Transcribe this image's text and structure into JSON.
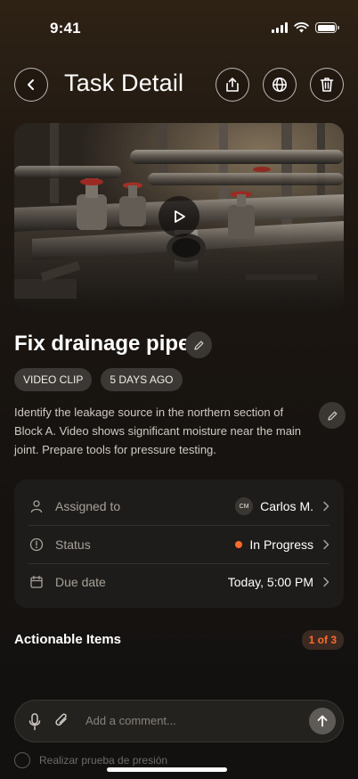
{
  "status_bar": {
    "time": "9:41"
  },
  "header": {
    "title": "Task Detail",
    "back_icon": "chevron-left-icon",
    "share_icon": "share-icon",
    "globe_icon": "globe-icon",
    "delete_icon": "trash-icon"
  },
  "media": {
    "play_icon": "play-icon"
  },
  "task": {
    "title": "Fix drainage pipe",
    "chips": [
      "VIDEO CLIP",
      "5 DAYS AGO"
    ],
    "description": "Identify the leakage source in the northern section of Block A. Video shows significant moisture near the main joint. Prepare tools for pressure testing."
  },
  "details": {
    "assigned_label": "Assigned to",
    "assignee_initials": "CM",
    "assignee_name": "Carlos M.",
    "status_label": "Status",
    "status_value": "In Progress",
    "due_label": "Due date",
    "due_value": "Today, 5:00 PM"
  },
  "actionable": {
    "title": "Actionable Items",
    "count": "1 of 3",
    "peek_item": "Realizar prueba de presión"
  },
  "comment": {
    "placeholder": "Add a comment..."
  },
  "colors": {
    "accent": "#ff6a2c",
    "card": "#1e1c1a"
  }
}
